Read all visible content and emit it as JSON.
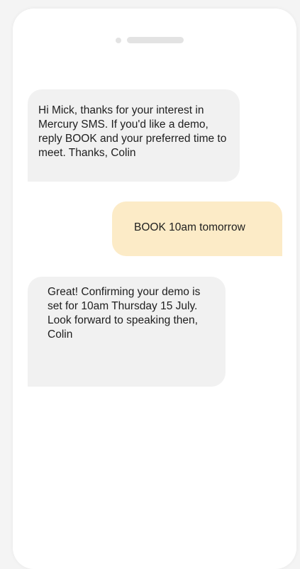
{
  "conversation": {
    "messages": [
      {
        "direction": "incoming",
        "text": "Hi Mick, thanks for your interest in Mercury SMS. If you'd like a demo, reply BOOK and your preferred time to meet. Thanks, Colin"
      },
      {
        "direction": "outgoing",
        "text": "BOOK 10am tomorrow"
      },
      {
        "direction": "incoming",
        "text": "Great! Confirming your demo is set for 10am Thursday 15 July. Look forward to speaking then, Colin"
      }
    ]
  },
  "colors": {
    "incoming_bubble": "#f1f1f1",
    "outgoing_bubble": "#fcebc7",
    "phone_bg": "#ffffff",
    "page_bg": "#f4f4f4"
  }
}
